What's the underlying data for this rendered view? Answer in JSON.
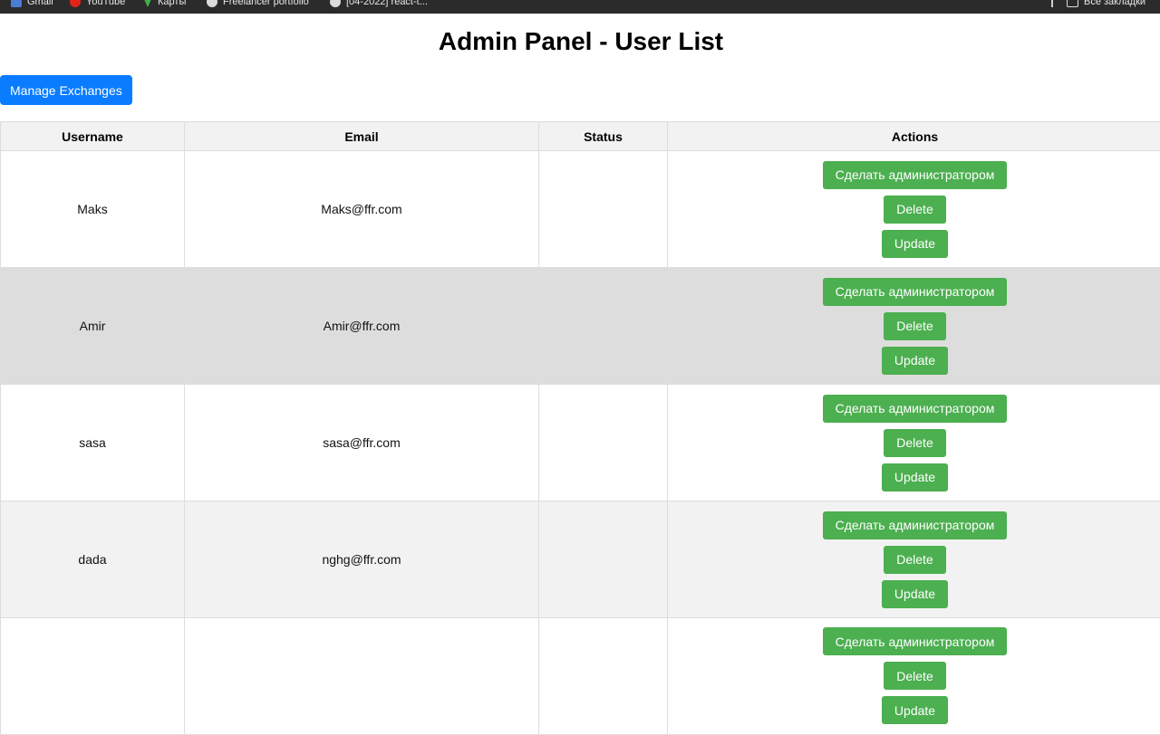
{
  "browser": {
    "bookmarks": [
      {
        "label": "Gmail",
        "icon": "gmail-icon"
      },
      {
        "label": "YouTube",
        "icon": "youtube-icon"
      },
      {
        "label": "Карты",
        "icon": "maps-icon"
      },
      {
        "label": "Freelancer portfolio",
        "icon": "globe-icon"
      },
      {
        "label": "[04-2022] react-t...",
        "icon": "globe-icon"
      }
    ],
    "all_bookmarks": "Все закладки"
  },
  "page": {
    "title": "Admin Panel - User List",
    "manage_button": "Manage Exchanges"
  },
  "table": {
    "columns": [
      "Username",
      "Email",
      "Status",
      "Actions"
    ],
    "rows": [
      {
        "username": "Maks",
        "email": "Maks@ffr.com",
        "status": ""
      },
      {
        "username": "Amir",
        "email": "Amir@ffr.com",
        "status": ""
      },
      {
        "username": "sasa",
        "email": "sasa@ffr.com",
        "status": ""
      },
      {
        "username": "dada",
        "email": "nghg@ffr.com",
        "status": ""
      },
      {
        "username": "",
        "email": "",
        "status": ""
      }
    ],
    "actions": {
      "make_admin": "Сделать администратором",
      "delete": "Delete",
      "update": "Update"
    }
  },
  "colors": {
    "primary": "#0a7cff",
    "success": "#4caf50",
    "header_bg": "#f2f2f2",
    "row_highlight": "#dddddd"
  }
}
